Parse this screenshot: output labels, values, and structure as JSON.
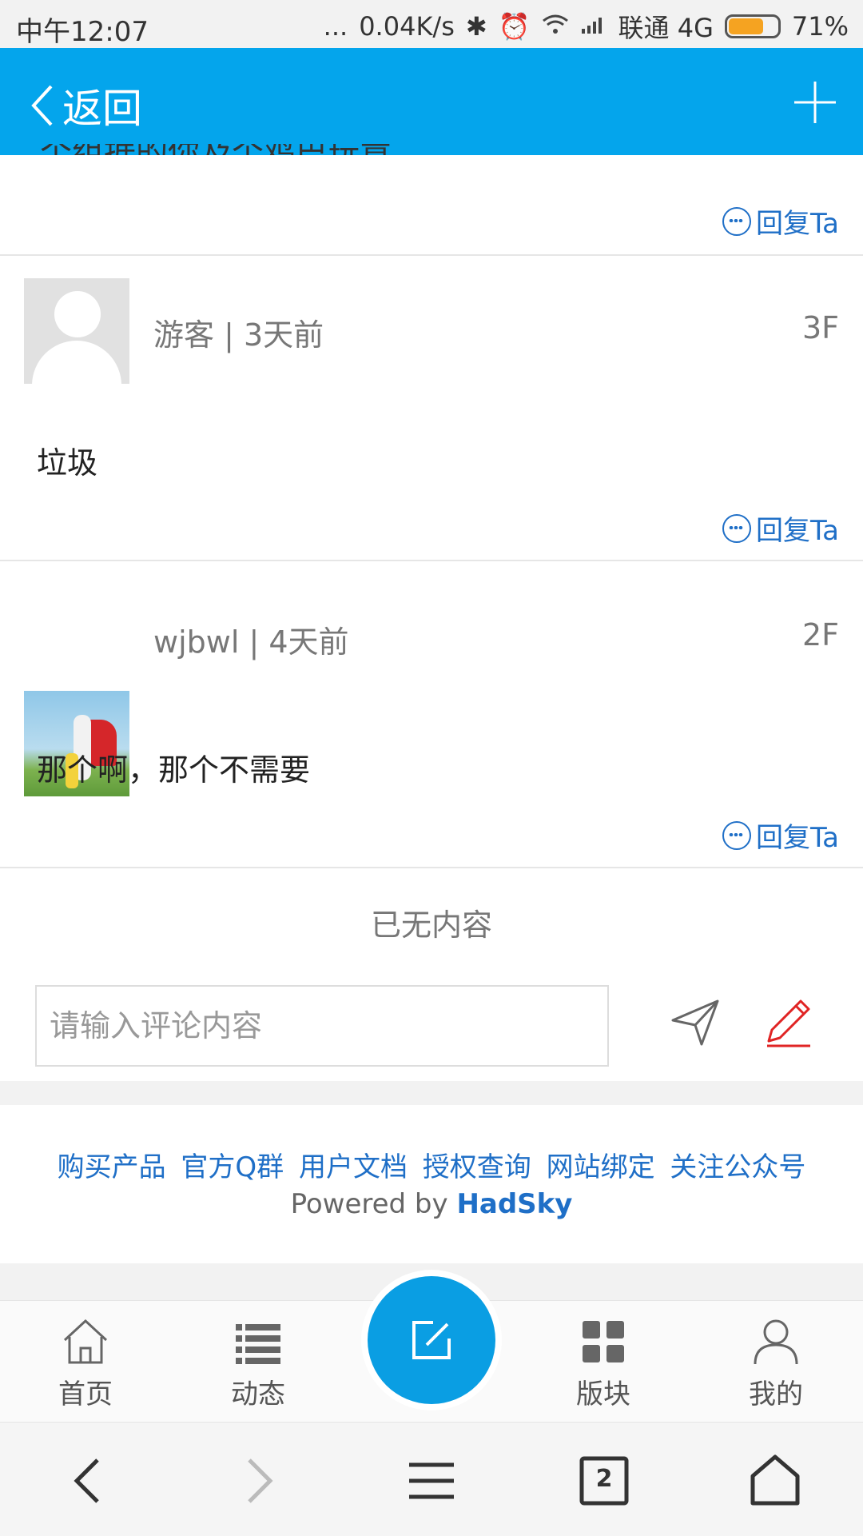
{
  "status_bar": {
    "time": "中午12:07",
    "dots": "...",
    "speed": "0.04K/s",
    "carrier": "联通 4G",
    "battery": "71%"
  },
  "header": {
    "back_label": "返回",
    "back_icon": "chevron-left-icon",
    "add_icon": "plus-icon",
    "color": "#04a5ec"
  },
  "clipped_text": "个组据的你及个鸡巴玩意，",
  "reply_label": "回复Ta",
  "posts": [
    {
      "user": "游客",
      "time": "3天前",
      "meta": "游客 | 3天前",
      "floor": "3F",
      "content": "垃圾",
      "avatar": "default-avatar"
    },
    {
      "user": "wjbwl",
      "time": "4天前",
      "meta": "wjbwl | 4天前",
      "floor": "2F",
      "content": "那个啊，那个不需要",
      "avatar": "photo-avatar"
    }
  ],
  "no_more": "已无内容",
  "comment": {
    "placeholder": "请输入评论内容"
  },
  "footer": {
    "links": [
      "购买产品",
      "官方Q群",
      "用户文档",
      "授权查询",
      "网站绑定",
      "关注公众号"
    ],
    "powered_prefix": "Powered by",
    "powered_brand": "HadSky"
  },
  "bottom_nav": [
    {
      "label": "首页",
      "icon": "home-icon"
    },
    {
      "label": "动态",
      "icon": "list-icon"
    },
    {
      "label": "",
      "icon": "compose-icon"
    },
    {
      "label": "版块",
      "icon": "grid-icon"
    },
    {
      "label": "我的",
      "icon": "user-icon"
    }
  ],
  "system_nav": {
    "tabs_count": "2"
  },
  "colors": {
    "accent": "#04a5ec",
    "link": "#1f6fc7",
    "edit_icon": "#e02424"
  }
}
